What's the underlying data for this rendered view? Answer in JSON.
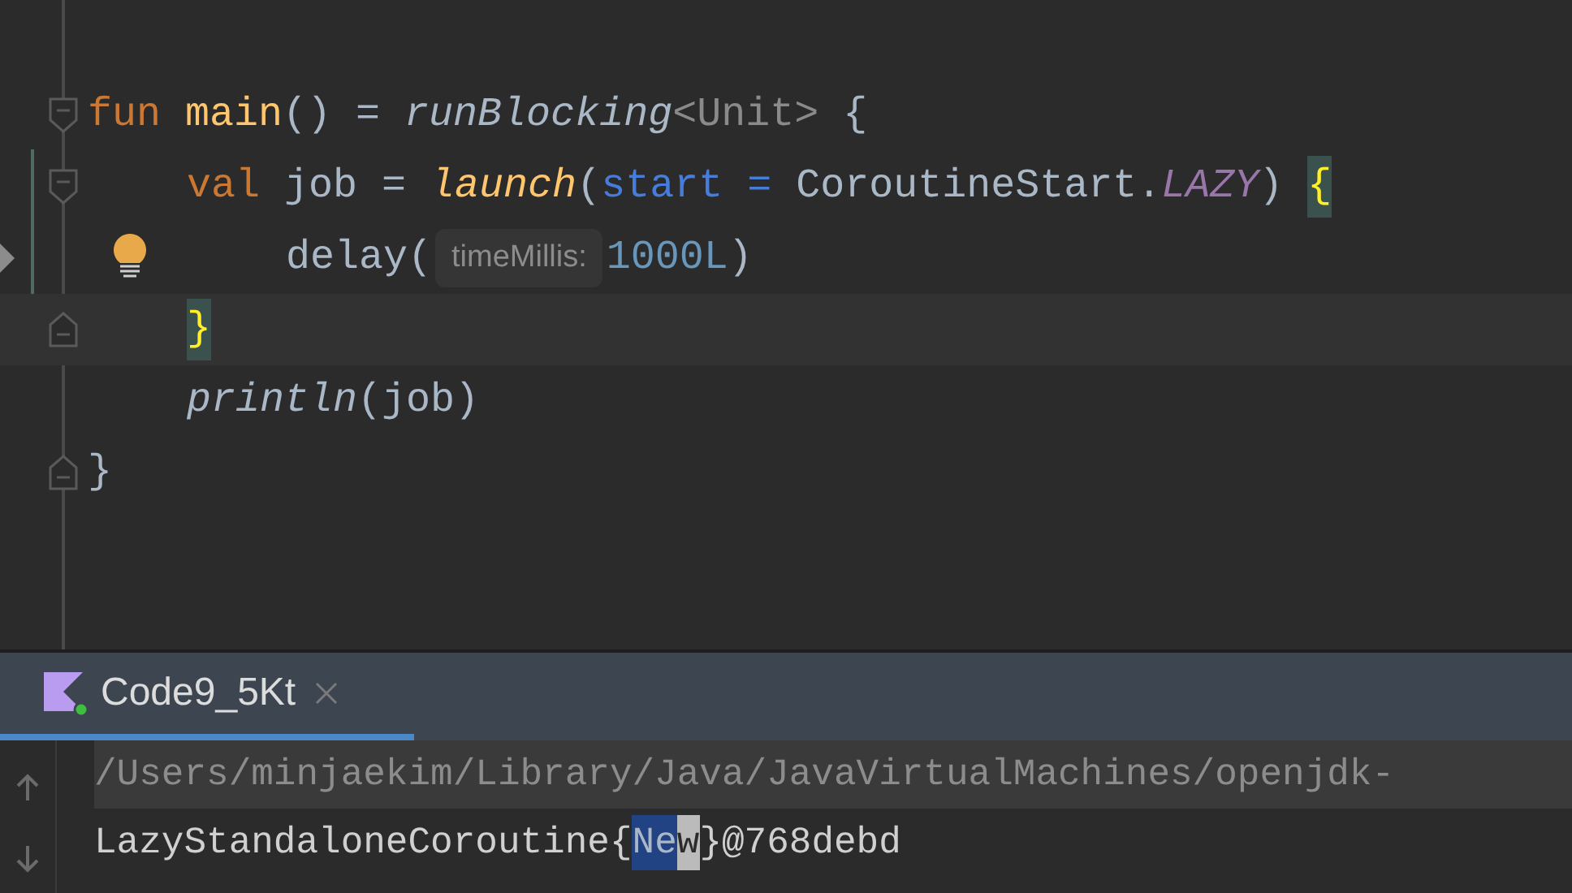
{
  "editor": {
    "lines": [
      {
        "fold_start": true,
        "fold_end": false,
        "bulb": false,
        "current": false,
        "tokens": [
          {
            "kind": "keyword",
            "text": "fun "
          },
          {
            "kind": "decl",
            "text": "main"
          },
          {
            "kind": "plain",
            "text": "() = "
          },
          {
            "kind": "call",
            "text": "runBlocking"
          },
          {
            "kind": "type",
            "text": "<Unit>"
          },
          {
            "kind": "plain",
            "text": " {"
          }
        ],
        "children": [
          {
            "fold_start": true,
            "fold_end": false,
            "bulb": false,
            "current": false,
            "tokens": [
              {
                "kind": "keyword",
                "text": "val "
              },
              {
                "kind": "plain",
                "text": "job = "
              },
              {
                "kind": "launch",
                "text": "launch"
              },
              {
                "kind": "plain",
                "text": "("
              },
              {
                "kind": "param",
                "text": "start ="
              },
              {
                "kind": "plain",
                "text": " CoroutineStart."
              },
              {
                "kind": "constant",
                "text": "LAZY"
              },
              {
                "kind": "plain",
                "text": ") "
              },
              {
                "kind": "brace",
                "text": "{"
              }
            ],
            "children": [
              {
                "fold_start": false,
                "fold_end": false,
                "bulb": true,
                "current": false,
                "tokens": [
                  {
                    "kind": "plain",
                    "text": "delay("
                  },
                  {
                    "kind": "hint",
                    "text": "timeMillis:"
                  },
                  {
                    "kind": "number",
                    "text": "1000L"
                  },
                  {
                    "kind": "plain",
                    "text": ")"
                  }
                ]
              }
            ]
          },
          {
            "fold_start": false,
            "fold_end": true,
            "bulb": false,
            "current": true,
            "tokens": [
              {
                "kind": "brace",
                "text": "}"
              }
            ]
          },
          {
            "fold_start": false,
            "fold_end": false,
            "bulb": false,
            "current": false,
            "tokens": [
              {
                "kind": "call",
                "text": "println"
              },
              {
                "kind": "plain",
                "text": "(job)"
              }
            ]
          }
        ]
      },
      {
        "fold_start": false,
        "fold_end": true,
        "bulb": false,
        "current": false,
        "tokens": [
          {
            "kind": "plain",
            "text": "}"
          }
        ]
      }
    ]
  },
  "run_tab": {
    "label": "Code9_5Kt",
    "selected": true
  },
  "console": {
    "lines": [
      {
        "kind": "command",
        "segments": [
          {
            "kind": "plain",
            "text": "/Users/minjaekim/Library/Java/JavaVirtualMachines/openjdk-"
          }
        ]
      },
      {
        "kind": "output",
        "segments": [
          {
            "kind": "plain",
            "text": "LazyStandaloneCoroutine{"
          },
          {
            "kind": "selected",
            "text": "Ne"
          },
          {
            "kind": "caret",
            "text": "w"
          },
          {
            "kind": "plain",
            "text": "}@768debd"
          }
        ]
      }
    ]
  }
}
